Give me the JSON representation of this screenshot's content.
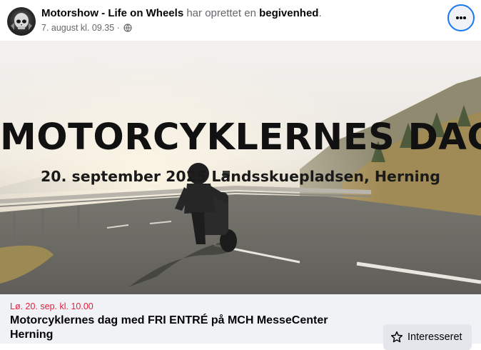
{
  "post": {
    "page_name": "Motorshow - Life on Wheels",
    "action_text": "har oprettet en",
    "action_object": "begivenhed",
    "period": ".",
    "timestamp": "7. august kl. 09.35",
    "separator": "·",
    "privacy_icon": "globe-icon",
    "avatar_icon": "skull-helmet-logo",
    "more_icon": "more-horizontal-icon"
  },
  "banner": {
    "title": "MOTORCYKLERNES DAG",
    "subtitle": "20. september 2025 Landsskuepladsen, Herning"
  },
  "event": {
    "date": "Lø. 20. sep. kl. 10.00",
    "title": "Motorcyklernes dag med FRI ENTRÉ på MCH MesseCenter Herning",
    "interested_label": "Interesseret",
    "interested_icon": "star-icon"
  },
  "colors": {
    "event_date": "#e41e3f",
    "focus_ring": "#1877f2",
    "footer_bg": "#f0f2f5",
    "button_bg": "#e4e6eb"
  }
}
